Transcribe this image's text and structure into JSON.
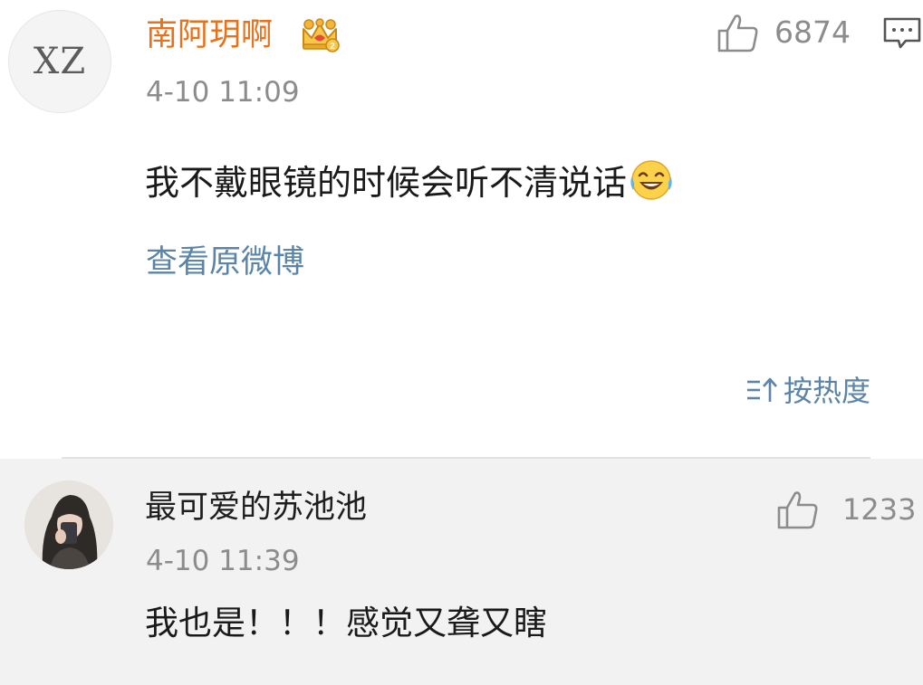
{
  "colors": {
    "username": "#e8721c",
    "link": "#5b84a8",
    "meta": "#8c8c8c",
    "text": "#1a1a1a",
    "reply_bg": "#f2f2f2"
  },
  "main_comment": {
    "avatar_text": "XZ",
    "username": "南阿玥啊",
    "badge_icon": "crown-badge-icon",
    "timestamp": "4-10 11:09",
    "like_count": "6874",
    "body": "我不戴眼镜的时候会听不清说话",
    "emoji": "laughing-tears-emoji-icon",
    "view_original": "查看原微博"
  },
  "sort": {
    "label": "按热度",
    "icon": "sort-icon"
  },
  "reply": {
    "username": "最可爱的苏池池",
    "timestamp": "4-10 11:39",
    "like_count": "1233",
    "body": "我也是！！！感觉又聋又瞎"
  }
}
